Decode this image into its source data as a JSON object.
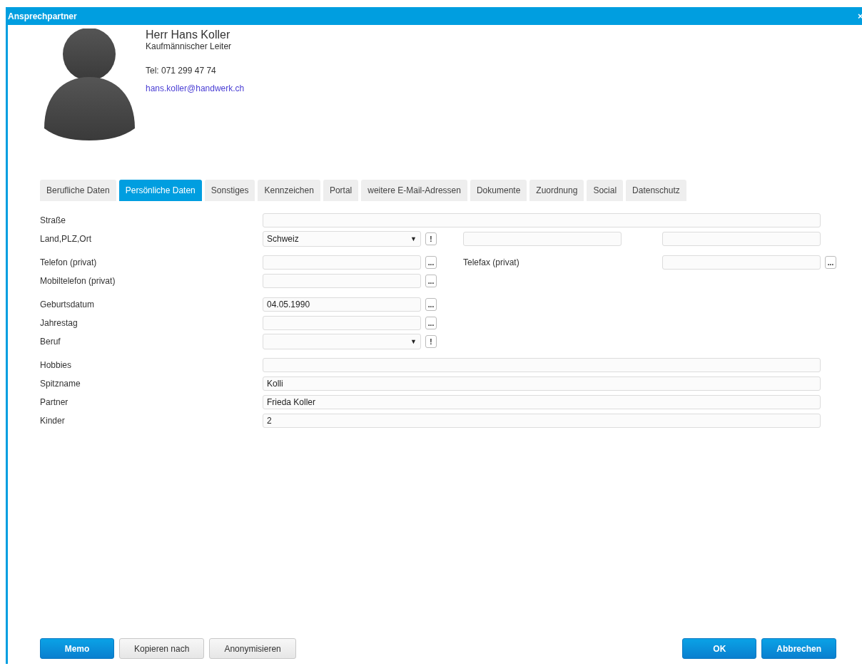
{
  "window": {
    "title": "Ansprechpartner",
    "close": "×"
  },
  "contact": {
    "name": "Herr Hans Koller",
    "position": "Kaufmännischer Leiter",
    "phone": "Tel: 071 299 47 74",
    "email": "hans.koller@handwerk.ch"
  },
  "tabs": [
    {
      "label": "Berufliche Daten",
      "selected": false
    },
    {
      "label": "Persönliche Daten",
      "selected": true
    },
    {
      "label": "Sonstiges",
      "selected": false
    },
    {
      "label": "Kennzeichen",
      "selected": false
    },
    {
      "label": "Portal",
      "selected": false
    },
    {
      "label": "weitere E-Mail-Adressen",
      "selected": false
    },
    {
      "label": "Dokumente",
      "selected": false
    },
    {
      "label": "Zuordnung",
      "selected": false
    },
    {
      "label": "Social",
      "selected": false
    },
    {
      "label": "Datenschutz",
      "selected": false
    }
  ],
  "form": {
    "groups": [
      {
        "rows": [
          {
            "label": "Straße",
            "controls": [
              {
                "kind": "wide-input"
              }
            ]
          },
          {
            "label": "Land,PLZ,Ort",
            "controls": [
              {
                "kind": "select",
                "value": "Schweiz",
                "arrow": "▼"
              },
              {
                "kind": "button",
                "text": "!"
              },
              {
                "kind": "input"
              },
              {
                "kind": "input"
              }
            ]
          }
        ]
      },
      {
        "rows": [
          {
            "label": "Telefon (privat)",
            "controls": [
              {
                "kind": "input"
              },
              {
                "kind": "button",
                "text": "..."
              },
              {
                "kind": "label",
                "text": "Telefax (privat)"
              },
              {
                "kind": "input"
              },
              {
                "kind": "button",
                "text": "..."
              }
            ]
          },
          {
            "label": "Mobiltelefon (privat)",
            "controls": [
              {
                "kind": "input"
              },
              {
                "kind": "button",
                "text": "..."
              }
            ]
          }
        ]
      },
      {
        "rows": [
          {
            "label": "Geburtsdatum",
            "controls": [
              {
                "kind": "input",
                "value": "04.05.1990"
              },
              {
                "kind": "button",
                "text": "..."
              }
            ]
          },
          {
            "label": "Jahrestag",
            "controls": [
              {
                "kind": "input"
              },
              {
                "kind": "button",
                "text": "..."
              }
            ]
          },
          {
            "label": "Beruf",
            "controls": [
              {
                "kind": "select",
                "arrow": "▼"
              },
              {
                "kind": "button",
                "text": "!"
              }
            ]
          }
        ]
      },
      {
        "rows": [
          {
            "label": "Hobbies",
            "controls": [
              {
                "kind": "wide-input"
              }
            ]
          },
          {
            "label": "Spitzname",
            "controls": [
              {
                "kind": "wide-input",
                "value": "Kolli"
              }
            ]
          },
          {
            "label": "Partner",
            "controls": [
              {
                "kind": "wide-input",
                "value": "Frieda Koller"
              }
            ]
          },
          {
            "label": "Kinder",
            "controls": [
              {
                "kind": "wide-input",
                "value": "2"
              }
            ]
          }
        ]
      }
    ]
  },
  "footer": {
    "left": [
      {
        "label": "Memo",
        "primary": true
      },
      {
        "label": "Kopieren nach",
        "primary": false
      },
      {
        "label": "Anonymisieren",
        "primary": false
      }
    ],
    "right": [
      {
        "label": "OK",
        "primary": true
      },
      {
        "label": "Abbrechen",
        "primary": true
      }
    ]
  }
}
